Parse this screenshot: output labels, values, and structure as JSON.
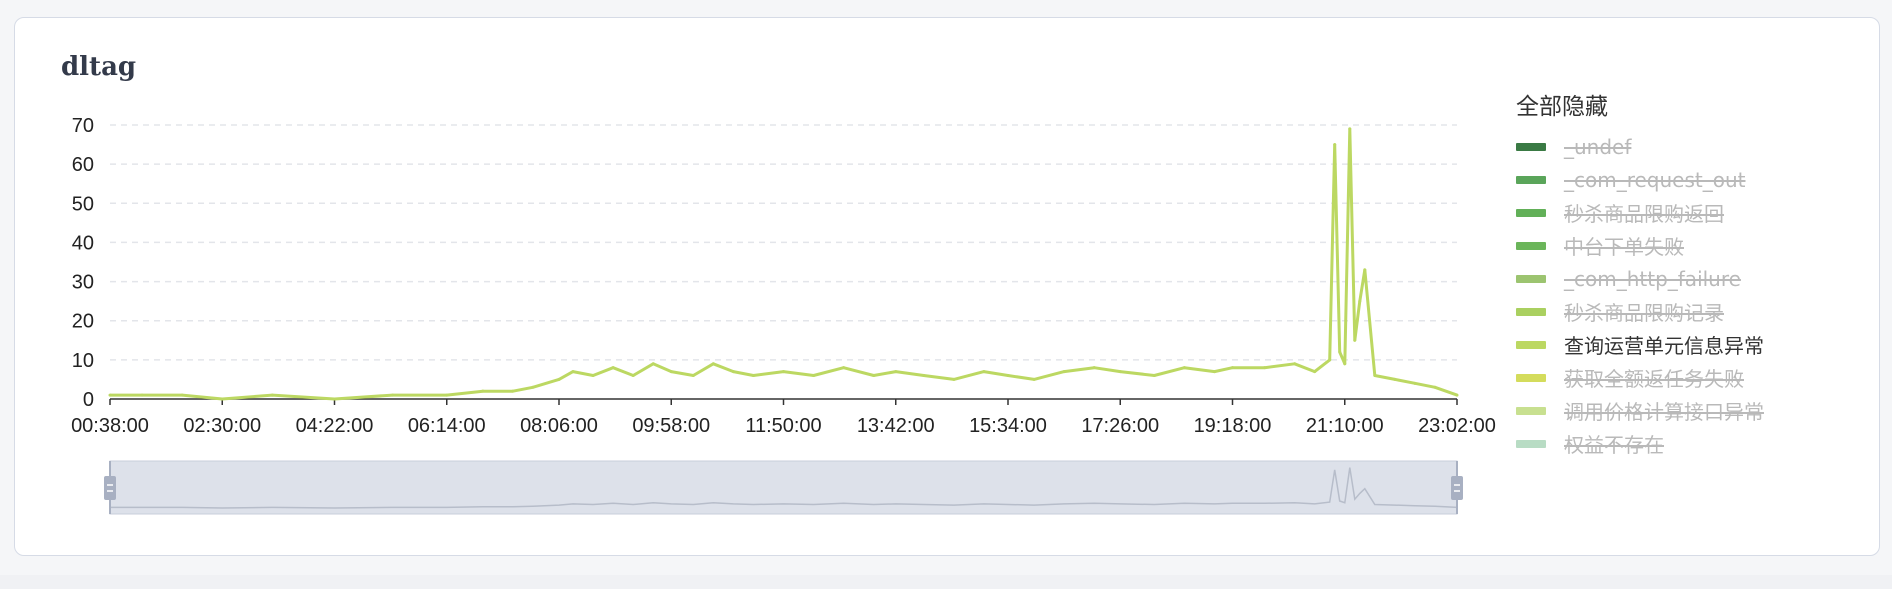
{
  "card": {
    "title": "dltag"
  },
  "legend": {
    "toggle_label": "全部隐藏",
    "items": [
      {
        "name": "_undef",
        "color": "#3a7a44",
        "visible": false
      },
      {
        "name": "_com_request_out",
        "color": "#5aa55a",
        "visible": false
      },
      {
        "name": "秒杀商品限购返回",
        "color": "#62b058",
        "visible": false
      },
      {
        "name": "中台下单失败",
        "color": "#6bb55a",
        "visible": false
      },
      {
        "name": "_com_http_failure",
        "color": "#9cc470",
        "visible": false
      },
      {
        "name": "秒杀商品限购记录",
        "color": "#aad060",
        "visible": false
      },
      {
        "name": "查询运营单元信息异常",
        "color": "#bcd862",
        "visible": true
      },
      {
        "name": "获取全额返任务失败",
        "color": "#d4dc5c",
        "visible": false
      },
      {
        "name": "调用价格计算接口异常",
        "color": "#c8e090",
        "visible": false
      },
      {
        "name": "权益不存在",
        "color": "#b8dcc4",
        "visible": false
      }
    ]
  },
  "chart_data": {
    "type": "line",
    "title": "dltag",
    "xlabel": "",
    "ylabel": "",
    "ylim": [
      0,
      70
    ],
    "yticks": [
      0,
      10,
      20,
      30,
      40,
      50,
      60,
      70
    ],
    "x_range": [
      "00:38:00",
      "23:02:00"
    ],
    "xticks": [
      "00:38:00",
      "02:30:00",
      "04:22:00",
      "06:14:00",
      "08:06:00",
      "09:58:00",
      "11:50:00",
      "13:42:00",
      "15:34:00",
      "17:26:00",
      "19:18:00",
      "21:10:00",
      "23:02:00"
    ],
    "grid": {
      "y": true,
      "x": false,
      "style": "dashed"
    },
    "legend_position": "right",
    "series": [
      {
        "name": "查询运营单元信息异常",
        "color": "#bcd862",
        "x": [
          "00:38:00",
          "01:10:00",
          "01:50:00",
          "02:30:00",
          "03:20:00",
          "04:22:00",
          "05:20:00",
          "06:14:00",
          "06:50:00",
          "07:20:00",
          "07:40:00",
          "08:06:00",
          "08:20:00",
          "08:40:00",
          "09:00:00",
          "09:20:00",
          "09:40:00",
          "09:58:00",
          "10:20:00",
          "10:40:00",
          "11:00:00",
          "11:20:00",
          "11:50:00",
          "12:20:00",
          "12:50:00",
          "13:20:00",
          "13:42:00",
          "14:10:00",
          "14:40:00",
          "15:10:00",
          "15:34:00",
          "16:00:00",
          "16:30:00",
          "17:00:00",
          "17:26:00",
          "18:00:00",
          "18:30:00",
          "19:00:00",
          "19:18:00",
          "19:50:00",
          "20:20:00",
          "20:40:00",
          "20:55:00",
          "21:00:00",
          "21:05:00",
          "21:10:00",
          "21:15:00",
          "21:20:00",
          "21:25:00",
          "21:30:00",
          "21:40:00",
          "22:00:00",
          "22:20:00",
          "22:40:00",
          "23:02:00"
        ],
        "values": [
          1,
          1,
          1,
          0,
          1,
          0,
          1,
          1,
          2,
          2,
          3,
          5,
          7,
          6,
          8,
          6,
          9,
          7,
          6,
          9,
          7,
          6,
          7,
          6,
          8,
          6,
          7,
          6,
          5,
          7,
          6,
          5,
          7,
          8,
          7,
          6,
          8,
          7,
          8,
          8,
          9,
          7,
          10,
          65,
          12,
          9,
          69,
          15,
          25,
          33,
          6,
          5,
          4,
          3,
          1
        ]
      }
    ]
  }
}
